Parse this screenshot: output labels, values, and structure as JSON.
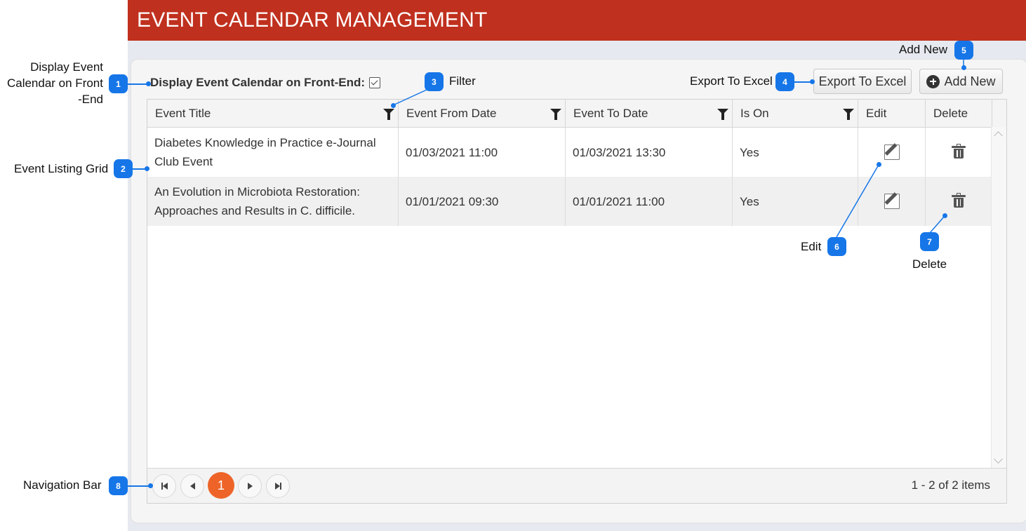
{
  "header": {
    "title": "EVENT CALENDAR MANAGEMENT"
  },
  "toolbar": {
    "front_end_label": "Display Event Calendar on Front-End:",
    "front_end_checked": true,
    "export_label": "Export To Excel",
    "add_label": "Add New"
  },
  "grid": {
    "columns": [
      "Event Title",
      "Event From Date",
      "Event To Date",
      "Is On",
      "Edit",
      "Delete"
    ],
    "rows": [
      {
        "title": "Diabetes Knowledge in Practice e-Journal Club Event",
        "from": "01/03/2021 11:00",
        "to": "01/03/2021 13:30",
        "is_on": "Yes"
      },
      {
        "title": "An Evolution in Microbiota Restoration: Approaches and Results in C. difficile.",
        "from": "01/01/2021 09:30",
        "to": "01/01/2021 11:00",
        "is_on": "Yes"
      }
    ]
  },
  "pager": {
    "current_page": "1",
    "info": "1 - 2 of 2 items"
  },
  "annotations": {
    "a1_label": "Display Event Calendar on Front -End",
    "a1_line1": "Display Event",
    "a1_line2": "Calendar on Front",
    "a1_line3": "-End",
    "a1_num": "1",
    "a2_label": "Event Listing Grid",
    "a2_num": "2",
    "a3_label": "Filter",
    "a3_num": "3",
    "a4_label": "Export To Excel",
    "a4_num": "4",
    "a5_label": "Add New",
    "a5_num": "5",
    "a6_label": "Edit",
    "a6_num": "6",
    "a7_label": "Delete",
    "a7_num": "7",
    "a8_label": "Navigation Bar",
    "a8_num": "8"
  },
  "colors": {
    "header": "#c0301e",
    "annotation": "#1676e8",
    "pager_active": "#ee6428"
  }
}
